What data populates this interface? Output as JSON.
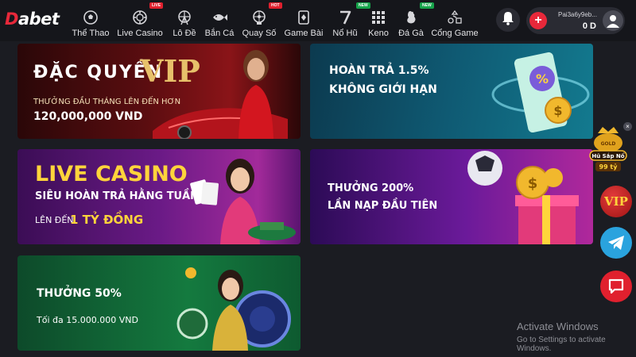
{
  "logo": {
    "first": "D",
    "rest": "abet"
  },
  "nav": [
    {
      "label": "Thể Thao",
      "icon": "soccer-ball-icon",
      "badge": ""
    },
    {
      "label": "Live Casino",
      "icon": "casino-chip-icon",
      "badge": "LIVE",
      "badge_color": "#e0202e"
    },
    {
      "label": "Lô Đề",
      "icon": "ferris-wheel-icon",
      "badge": ""
    },
    {
      "label": "Bắn Cá",
      "icon": "fish-icon",
      "badge": ""
    },
    {
      "label": "Quay Số",
      "icon": "lottery-wheel-icon",
      "badge": "HOT",
      "badge_color": "#e0202e"
    },
    {
      "label": "Game Bài",
      "icon": "playing-cards-icon",
      "badge": ""
    },
    {
      "label": "Nổ Hũ",
      "icon": "slot-seven-icon",
      "badge": "NEW",
      "badge_color": "#16a34a"
    },
    {
      "label": "Keno",
      "icon": "keno-grid-icon",
      "badge": ""
    },
    {
      "label": "Đá Gà",
      "icon": "rooster-icon",
      "badge": "NEW",
      "badge_color": "#16a34a"
    },
    {
      "label": "Cổng Game",
      "icon": "gamepad-icon",
      "badge": ""
    }
  ],
  "account": {
    "username": "Pai3a6y9eb...",
    "balance": "0 D"
  },
  "banners": {
    "vip": {
      "heading": "ĐẶC QUYỀN",
      "big": "VIP",
      "sub": "THƯỞNG ĐẦU THÁNG LÊN ĐẾN HƠN",
      "amount": "120,000,000 VND"
    },
    "hoan": {
      "line1": "HOÀN TRẢ 1.5%",
      "line2": "KHÔNG GIỚI HẠN",
      "percent_glyph": "%"
    },
    "live": {
      "line1": "LIVE CASINO",
      "line2": "SIÊU HOÀN TRẢ HẰNG TUẦN",
      "line3_prefix": "LÊN ĐẾN",
      "line3_amount": "1 TỶ ĐỒNG"
    },
    "bonus200": {
      "line1": "THƯỞNG 200%",
      "line2": "LẦN NẠP ĐẦU TIÊN"
    },
    "bonus50": {
      "line1": "THƯỞNG 50%",
      "line2": "Tối đa 15.000.000 VND"
    }
  },
  "jackpot": {
    "title": "Hũ Sắp Nổ",
    "amount": "99 tỷ",
    "label": "GOLD"
  },
  "floating": {
    "vip_label": "VIP"
  },
  "watermark": {
    "line1": "Activate Windows",
    "line2": "Go to Settings to activate Windows."
  },
  "colors": {
    "brand_red": "#e8283a",
    "gold": "#ffd43b",
    "nav_bg": "#15161b",
    "page_bg": "#1b1c22"
  }
}
